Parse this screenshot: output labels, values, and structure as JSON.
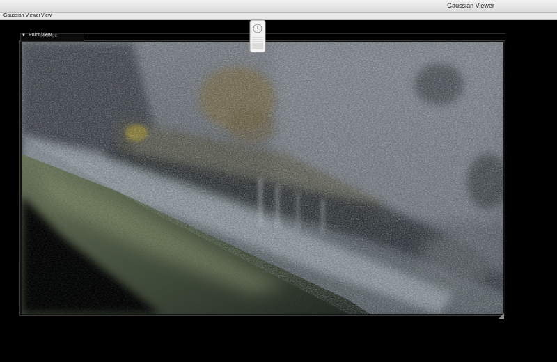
{
  "window": {
    "title": "Gaussian Viewer"
  },
  "menubar": {
    "items": [
      {
        "label": "Gaussian Viewer"
      },
      {
        "label": "View"
      }
    ]
  },
  "panel": {
    "title": "Point View",
    "ghost_label": "settings"
  },
  "icons": {
    "collapse": "triangle-down-icon",
    "widget": "clock-widget-icon",
    "resize": "resize-grip-icon"
  },
  "colors": {
    "background": "#000000",
    "titlebar": "#e6e6e6",
    "panel_text": "#e8e8e8"
  }
}
